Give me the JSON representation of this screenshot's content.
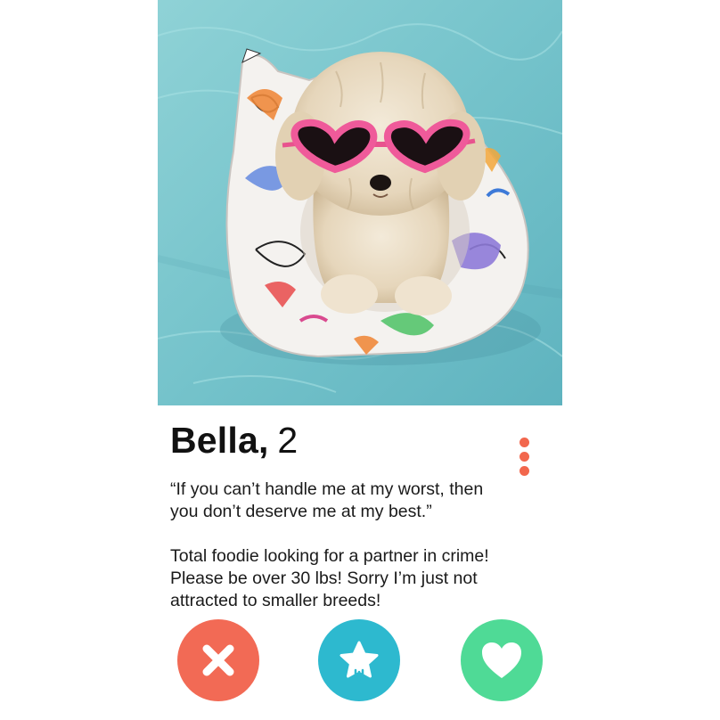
{
  "profile": {
    "name": "Bella",
    "comma": ",",
    "age": "2",
    "quote_line1": "“If you can’t handle me at my worst, then",
    "quote_line2": "you don’t deserve me at my best.”",
    "bio_line1": "Total foodie looking for a partner in crime!",
    "bio_line2": "Please be over 30 lbs! Sorry I’m just not",
    "bio_line3": "attracted to smaller breeds!"
  },
  "photo": {
    "subject": "dog-in-sunglasses-on-pool-float",
    "water_color": "#7ec9cf"
  },
  "menu": {
    "icon": "more-vertical-icon",
    "color": "#f2674d"
  },
  "actions": {
    "nope": {
      "icon": "close-icon",
      "color": "#f26a55"
    },
    "super_like": {
      "icon": "star-icon",
      "color": "#2db9cf"
    },
    "like": {
      "icon": "heart-icon",
      "color": "#4fda96"
    }
  }
}
